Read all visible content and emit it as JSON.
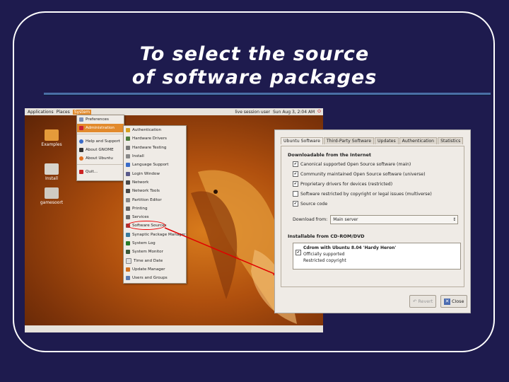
{
  "slide": {
    "title_line1": "To select the source",
    "title_line2": "of software packages"
  },
  "top_panel": {
    "applications": "Applications",
    "places": "Places",
    "system": "System",
    "session_user": "live session user",
    "clock": "Sun Aug 3, 2:04 AM"
  },
  "desktop_icons": [
    "Examples",
    "Install",
    "gamesoort"
  ],
  "system_menu": {
    "items": [
      "Preferences",
      "Administration",
      "Help and Support",
      "About GNOME",
      "About Ubuntu",
      "Quit..."
    ]
  },
  "admin_menu": {
    "items": [
      "Authentication",
      "Hardware Drivers",
      "Hardware Testing",
      "Install",
      "Language Support",
      "Login Window",
      "Network",
      "Network Tools",
      "Partition Editor",
      "Printing",
      "Services",
      "Software Sources",
      "Synaptic Package Manager",
      "System Log",
      "System Monitor",
      "Time and Date",
      "Update Manager",
      "Users and Groups"
    ],
    "highlighted": "Software Sources"
  },
  "dialog": {
    "tabs": [
      "Ubuntu Software",
      "Third-Party Software",
      "Updates",
      "Authentication",
      "Statistics"
    ],
    "active_tab": "Ubuntu Software",
    "section_internet": "Downloadable from the Internet",
    "options": [
      {
        "label": "Canonical supported Open Source software (main)",
        "checked": true
      },
      {
        "label": "Community maintained Open Source software (universe)",
        "checked": true
      },
      {
        "label": "Proprietary drivers for devices (restricted)",
        "checked": true
      },
      {
        "label": "Software restricted by copyright or legal issues (multiverse)",
        "checked": false
      },
      {
        "label": "Source code",
        "checked": true
      }
    ],
    "download_from_label": "Download from:",
    "download_from_value": "Main server",
    "section_cdrom": "Installable from CD-ROM/DVD",
    "cdrom": {
      "title": "Cdrom with Ubuntu 8.04 'Hardy Heron'",
      "line2": "Officially supported",
      "line3": "Restricted copyright"
    },
    "revert_label": "Revert",
    "close_label": "Close"
  },
  "colors": {
    "background": "#1e1b4e",
    "menu_highlight": "#e28a2c",
    "annotation": "#e00000"
  }
}
